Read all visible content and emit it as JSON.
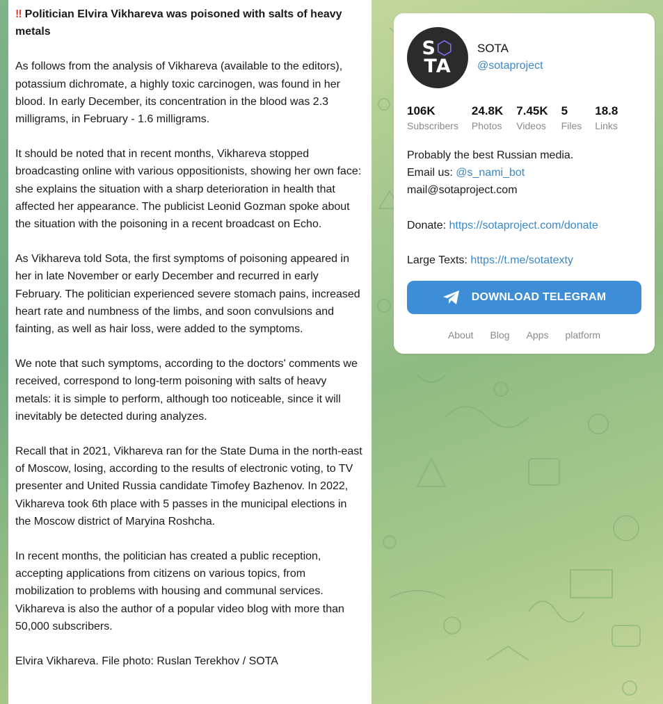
{
  "post": {
    "alert_icon": "double-exclamation-icon",
    "title": "Politician Elvira Vikhareva was poisoned with salts of heavy metals",
    "paragraphs": [
      "As follows from the analysis of Vikhareva (available to the editors), potassium dichromate, a highly toxic carcinogen, was found in her blood. In early December, its concentration in the blood was 2.3 milligrams, in February - 1.6 milligrams.",
      "It should be noted that in recent months, Vikhareva stopped broadcasting online with various oppositionists, showing her own face: she explains the situation with a sharp deterioration in health that affected her appearance. The publicist Leonid Gozman spoke about the situation with the poisoning in a recent broadcast on Echo.",
      "As Vikhareva told Sota, the first symptoms of poisoning appeared in her in late November or early December and recurred in early February. The politician experienced severe stomach pains, increased heart rate and numbness of the limbs, and soon convulsions and fainting, as well as hair loss, were added to the symptoms.",
      "We note that such symptoms, according to the doctors' comments we received, correspond to long-term poisoning with salts of heavy metals: it is simple to perform, although too noticeable, since it will inevitably be detected during analyzes.",
      "Recall that in 2021, Vikhareva ran for the State Duma in the north-east of Moscow, losing, according to the results of electronic voting, to TV presenter and United Russia candidate Timofey Bazhenov. In 2022, Vikhareva took 6th place with 5 passes in the municipal elections in the Moscow district of Maryina Roshcha.",
      "In recent months, the politician has created a public reception, accepting applications from citizens on various topics, from mobilization to problems with housing and communal services. Vikhareva is also the author of a popular video blog with more than 50,000 subscribers.",
      "Elvira Vikhareva. File photo: Ruslan Terekhov / SOTA"
    ]
  },
  "channel": {
    "avatar_line1_left": "S",
    "avatar_line1_right": "⬡",
    "avatar_line2": "TA",
    "name": "SOTA",
    "handle": "@sotaproject",
    "stats": [
      {
        "num": "106K",
        "label": "Subscribers"
      },
      {
        "num": "24.8K",
        "label": "Photos"
      },
      {
        "num": "7.45K",
        "label": "Videos"
      },
      {
        "num": "5",
        "label": "Files"
      },
      {
        "num": "18.8",
        "label": "Links"
      }
    ],
    "desc_line1": "Probably the best Russian media.",
    "email_label": "Email us: ",
    "email_bot": "@s_nami_bot",
    "email": "mail@sotaproject.com",
    "donate_label": "Donate: ",
    "donate_url": "https://sotaproject.com/donate",
    "large_label": "Large Texts: ",
    "large_url": "https://t.me/sotatexty",
    "download_label": "DOWNLOAD TELEGRAM",
    "footer_links": [
      "About",
      "Blog",
      "Apps",
      "platform"
    ]
  },
  "colors": {
    "accent": "#3d8ed6",
    "link": "#3a87c8",
    "alert": "#e53935"
  }
}
